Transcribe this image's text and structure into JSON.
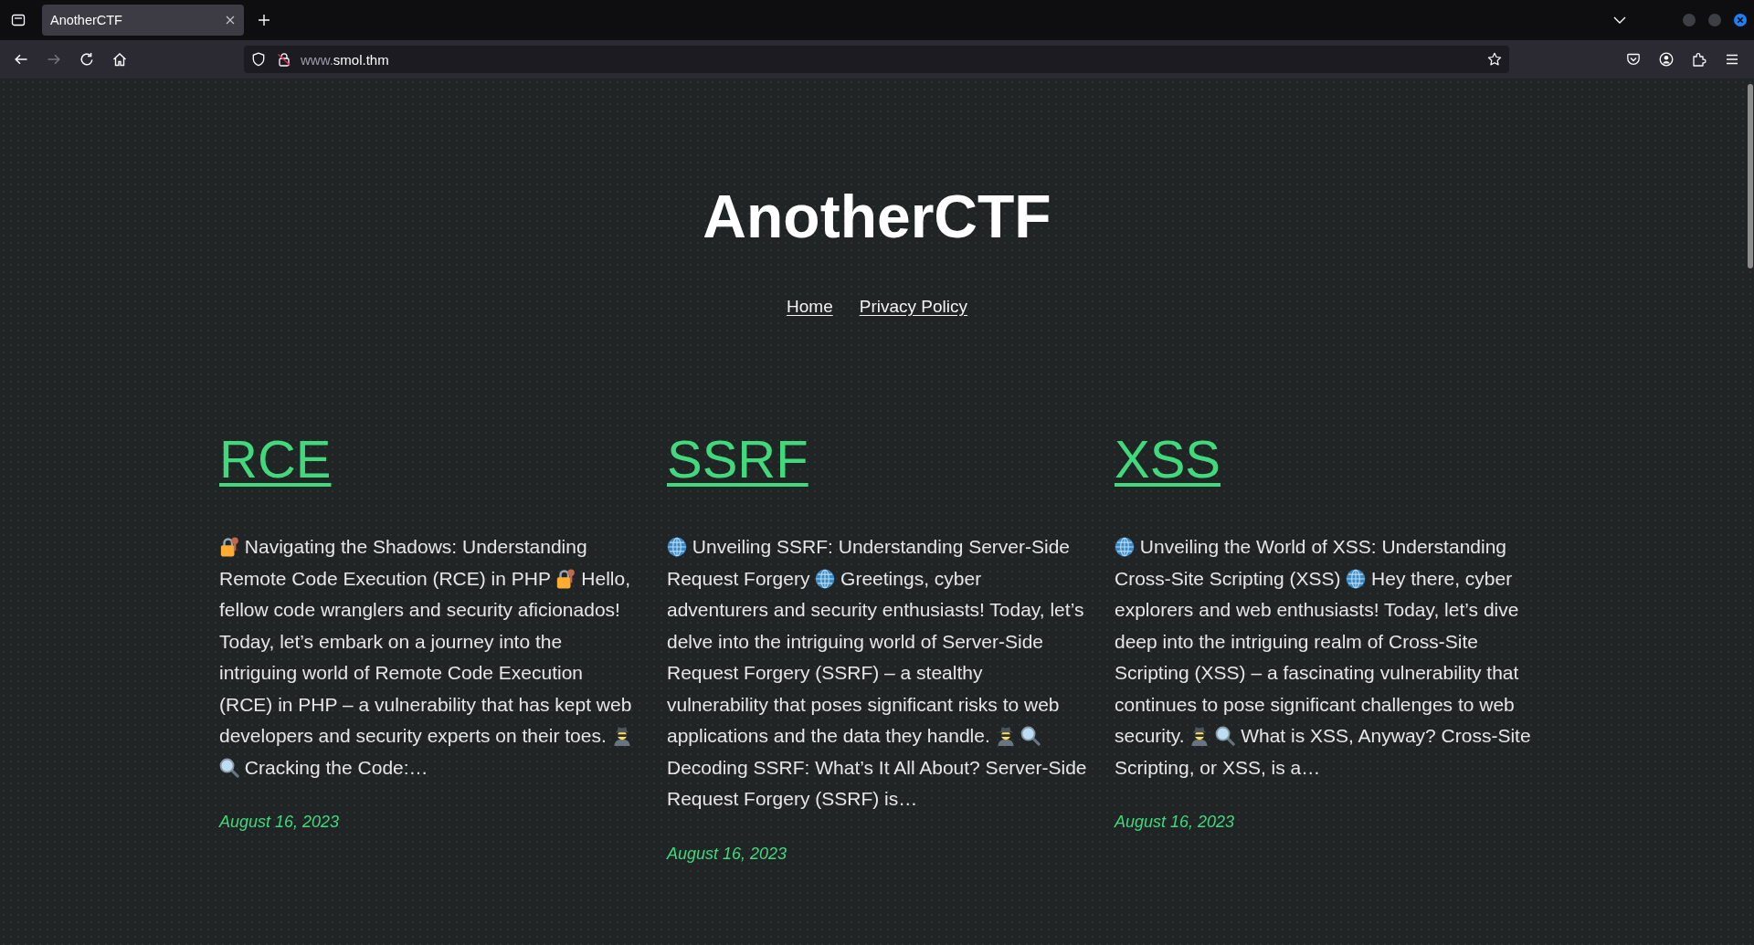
{
  "browser": {
    "tabs": [
      {
        "title": "AnotherCTF",
        "selected": true
      }
    ],
    "nav_buttons": [
      {
        "kind": "back",
        "disabled": false
      },
      {
        "kind": "forward",
        "disabled": true
      },
      {
        "kind": "reload",
        "disabled": false
      },
      {
        "kind": "home",
        "disabled": false
      }
    ],
    "address": {
      "dim": "www.",
      "host": "smol.thm"
    }
  },
  "site": {
    "title": "AnotherCTF",
    "nav": [
      {
        "label": "Home"
      },
      {
        "label": "Privacy Policy"
      }
    ]
  },
  "posts": [
    {
      "title": "RCE",
      "excerpt": [
        {
          "kind": "lock"
        },
        {
          "kind": "text",
          "text": "Navigating the Shadows: Understanding Remote Code Execution (RCE) in PHP"
        },
        {
          "kind": "lock"
        },
        {
          "kind": "text",
          "text": "Hello, fellow code wranglers and security aficionados! Today, let’s embark on a journey into the intriguing world of Remote Code Execution (RCE) in PHP – a vulnerability that has kept web developers and security experts on their toes."
        },
        {
          "kind": "detective"
        },
        {
          "kind": "magnifier"
        },
        {
          "kind": "text",
          "text": "Cracking the Code:…"
        }
      ],
      "date": "August 16, 2023"
    },
    {
      "title": "SSRF",
      "excerpt": [
        {
          "kind": "globe"
        },
        {
          "kind": "text",
          "text": "Unveiling SSRF: Understanding Server-Side Request Forgery"
        },
        {
          "kind": "globe"
        },
        {
          "kind": "text",
          "text": "Greetings, cyber adventurers and security enthusiasts! Today, let’s delve into the intriguing world of Server-Side Request Forgery (SSRF) – a stealthy vulnerability that poses significant risks to web applications and the data they handle."
        },
        {
          "kind": "detective"
        },
        {
          "kind": "magnifier"
        },
        {
          "kind": "text",
          "text": "Decoding SSRF: What’s It All About? Server-Side Request Forgery (SSRF) is…"
        }
      ],
      "date": "August 16, 2023"
    },
    {
      "title": "XSS",
      "excerpt": [
        {
          "kind": "globe"
        },
        {
          "kind": "text",
          "text": "Unveiling the World of XSS: Understanding Cross-Site Scripting (XSS)"
        },
        {
          "kind": "globe"
        },
        {
          "kind": "text",
          "text": "Hey there, cyber explorers and web enthusiasts! Today, let’s dive deep into the intriguing realm of Cross-Site Scripting (XSS) – a fascinating vulnerability that continues to pose significant challenges to web security."
        },
        {
          "kind": "detective"
        },
        {
          "kind": "magnifier"
        },
        {
          "kind": "text",
          "text": "What is XSS, Anyway? Cross-Site Scripting, or XSS, is a…"
        }
      ],
      "date": "August 16, 2023"
    }
  ]
}
